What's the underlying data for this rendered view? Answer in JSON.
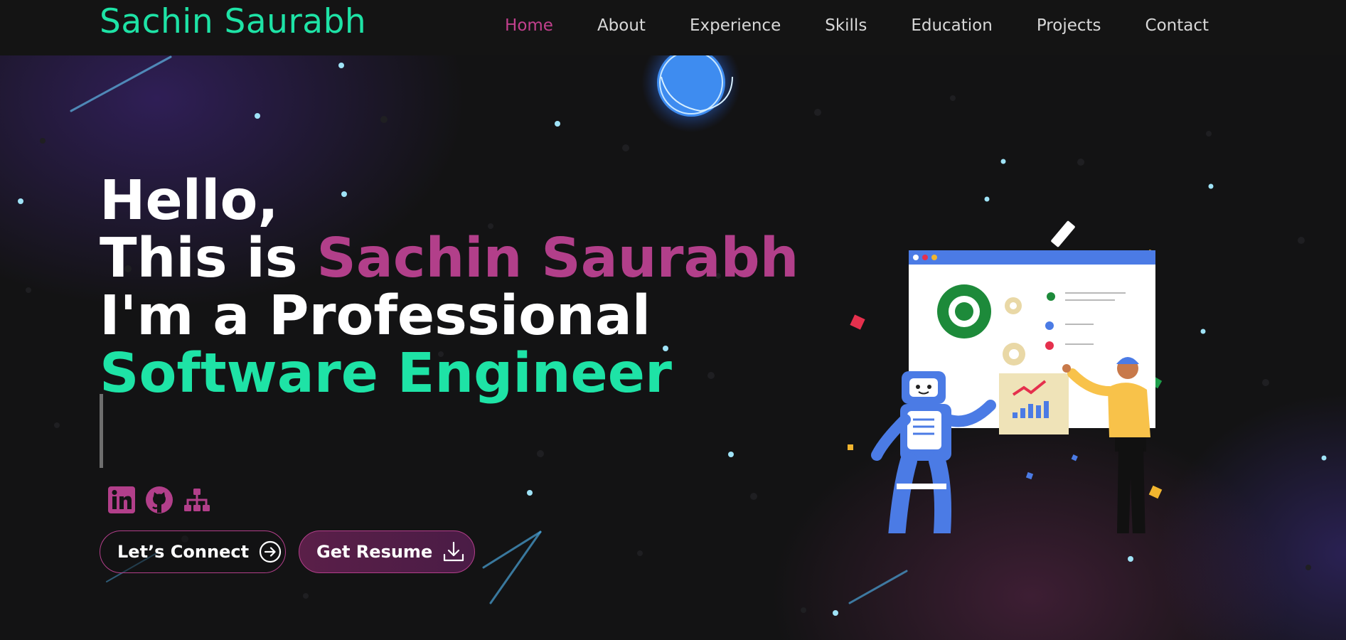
{
  "navbar": {
    "brand": "Sachin Saurabh",
    "links": [
      {
        "label": "Home",
        "active": true
      },
      {
        "label": "About"
      },
      {
        "label": "Experience"
      },
      {
        "label": "Skills"
      },
      {
        "label": "Education"
      },
      {
        "label": "Projects"
      },
      {
        "label": "Contact"
      }
    ]
  },
  "hero": {
    "greeting": "Hello,",
    "intro_prefix": "This is ",
    "name": "Sachin Saurabh",
    "role_prefix": "I'm a Professional",
    "role": "Software Engineer",
    "socials": [
      {
        "icon": "linkedin-icon"
      },
      {
        "icon": "github-icon"
      },
      {
        "icon": "sitemap-icon"
      }
    ],
    "buttons": {
      "connect_label": "Let’s Connect",
      "resume_label": "Get Resume"
    }
  },
  "colors": {
    "brand_green": "#1ee3a6",
    "accent_pink": "#b23f8a",
    "nav_active": "#c2408d",
    "background": "#121212"
  }
}
